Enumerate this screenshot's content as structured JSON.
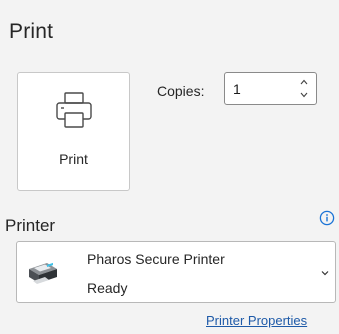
{
  "panel": {
    "title": "Print"
  },
  "print_button": {
    "label": "Print",
    "icon": "printer-icon"
  },
  "copies": {
    "label": "Copies:",
    "value": "1"
  },
  "printer": {
    "heading": "Printer",
    "selected_name": "Pharos Secure Printer",
    "selected_status": "Ready",
    "properties_link": "Printer Properties"
  },
  "colors": {
    "background": "#f3f3f3",
    "accent": "#1e5aa8",
    "info_icon": "#1a73d6"
  }
}
